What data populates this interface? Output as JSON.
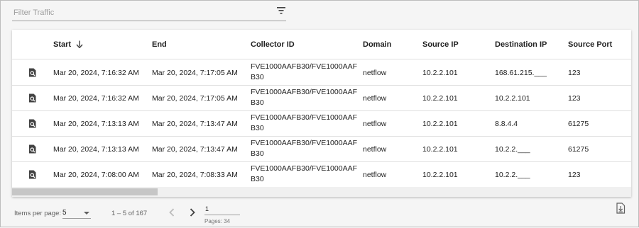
{
  "filter": {
    "placeholder": "Filter Traffic"
  },
  "table": {
    "columns": [
      "Start",
      "End",
      "Collector ID",
      "Domain",
      "Source IP",
      "Destination IP",
      "Source Port"
    ],
    "sort": {
      "column": "Start",
      "direction": "descending"
    },
    "rows": [
      {
        "start": "Mar 20, 2024, 7:16:32 AM",
        "end": "Mar 20, 2024, 7:17:05 AM",
        "collector": "FVE1000AAFB30/FVE1000AAFB30",
        "domain": "netflow",
        "source_ip": "10.2.2.101",
        "dest_ip": "168.61.215.___",
        "source_port": "123"
      },
      {
        "start": "Mar 20, 2024, 7:16:32 AM",
        "end": "Mar 20, 2024, 7:17:05 AM",
        "collector": "FVE1000AAFB30/FVE1000AAFB30",
        "domain": "netflow",
        "source_ip": "10.2.2.101",
        "dest_ip": "10.2.2.101",
        "source_port": "123"
      },
      {
        "start": "Mar 20, 2024, 7:13:13 AM",
        "end": "Mar 20, 2024, 7:13:47 AM",
        "collector": "FVE1000AAFB30/FVE1000AAFB30",
        "domain": "netflow",
        "source_ip": "10.2.2.101",
        "dest_ip": "8.8.4.4",
        "source_port": "61275"
      },
      {
        "start": "Mar 20, 2024, 7:13:13 AM",
        "end": "Mar 20, 2024, 7:13:47 AM",
        "collector": "FVE1000AAFB30/FVE1000AAFB30",
        "domain": "netflow",
        "source_ip": "10.2.2.101",
        "dest_ip": "10.2.2.___",
        "source_port": "61275"
      },
      {
        "start": "Mar 20, 2024, 7:08:00 AM",
        "end": "Mar 20, 2024, 7:08:33 AM",
        "collector": "FVE1000AAFB30/FVE1000AAFB30",
        "domain": "netflow",
        "source_ip": "10.2.2.101",
        "dest_ip": "10.2.2.___",
        "source_port": "123"
      }
    ]
  },
  "paginator": {
    "items_per_page_label": "Items per page:",
    "items_per_page": "5",
    "range": "1 – 5 of 167",
    "current_page": "1",
    "pages_label": "Pages: 34"
  },
  "icons": {
    "filter": "filter-list-icon",
    "sort": "arrow-down-icon",
    "row_action": "search-details-icon",
    "prev": "chevron-left-icon",
    "next": "chevron-right-icon",
    "export": "download-file-icon"
  },
  "colors": {
    "icon_dark": "#424242",
    "row_border": "#e0e0e0",
    "muted_text": "#616161"
  }
}
